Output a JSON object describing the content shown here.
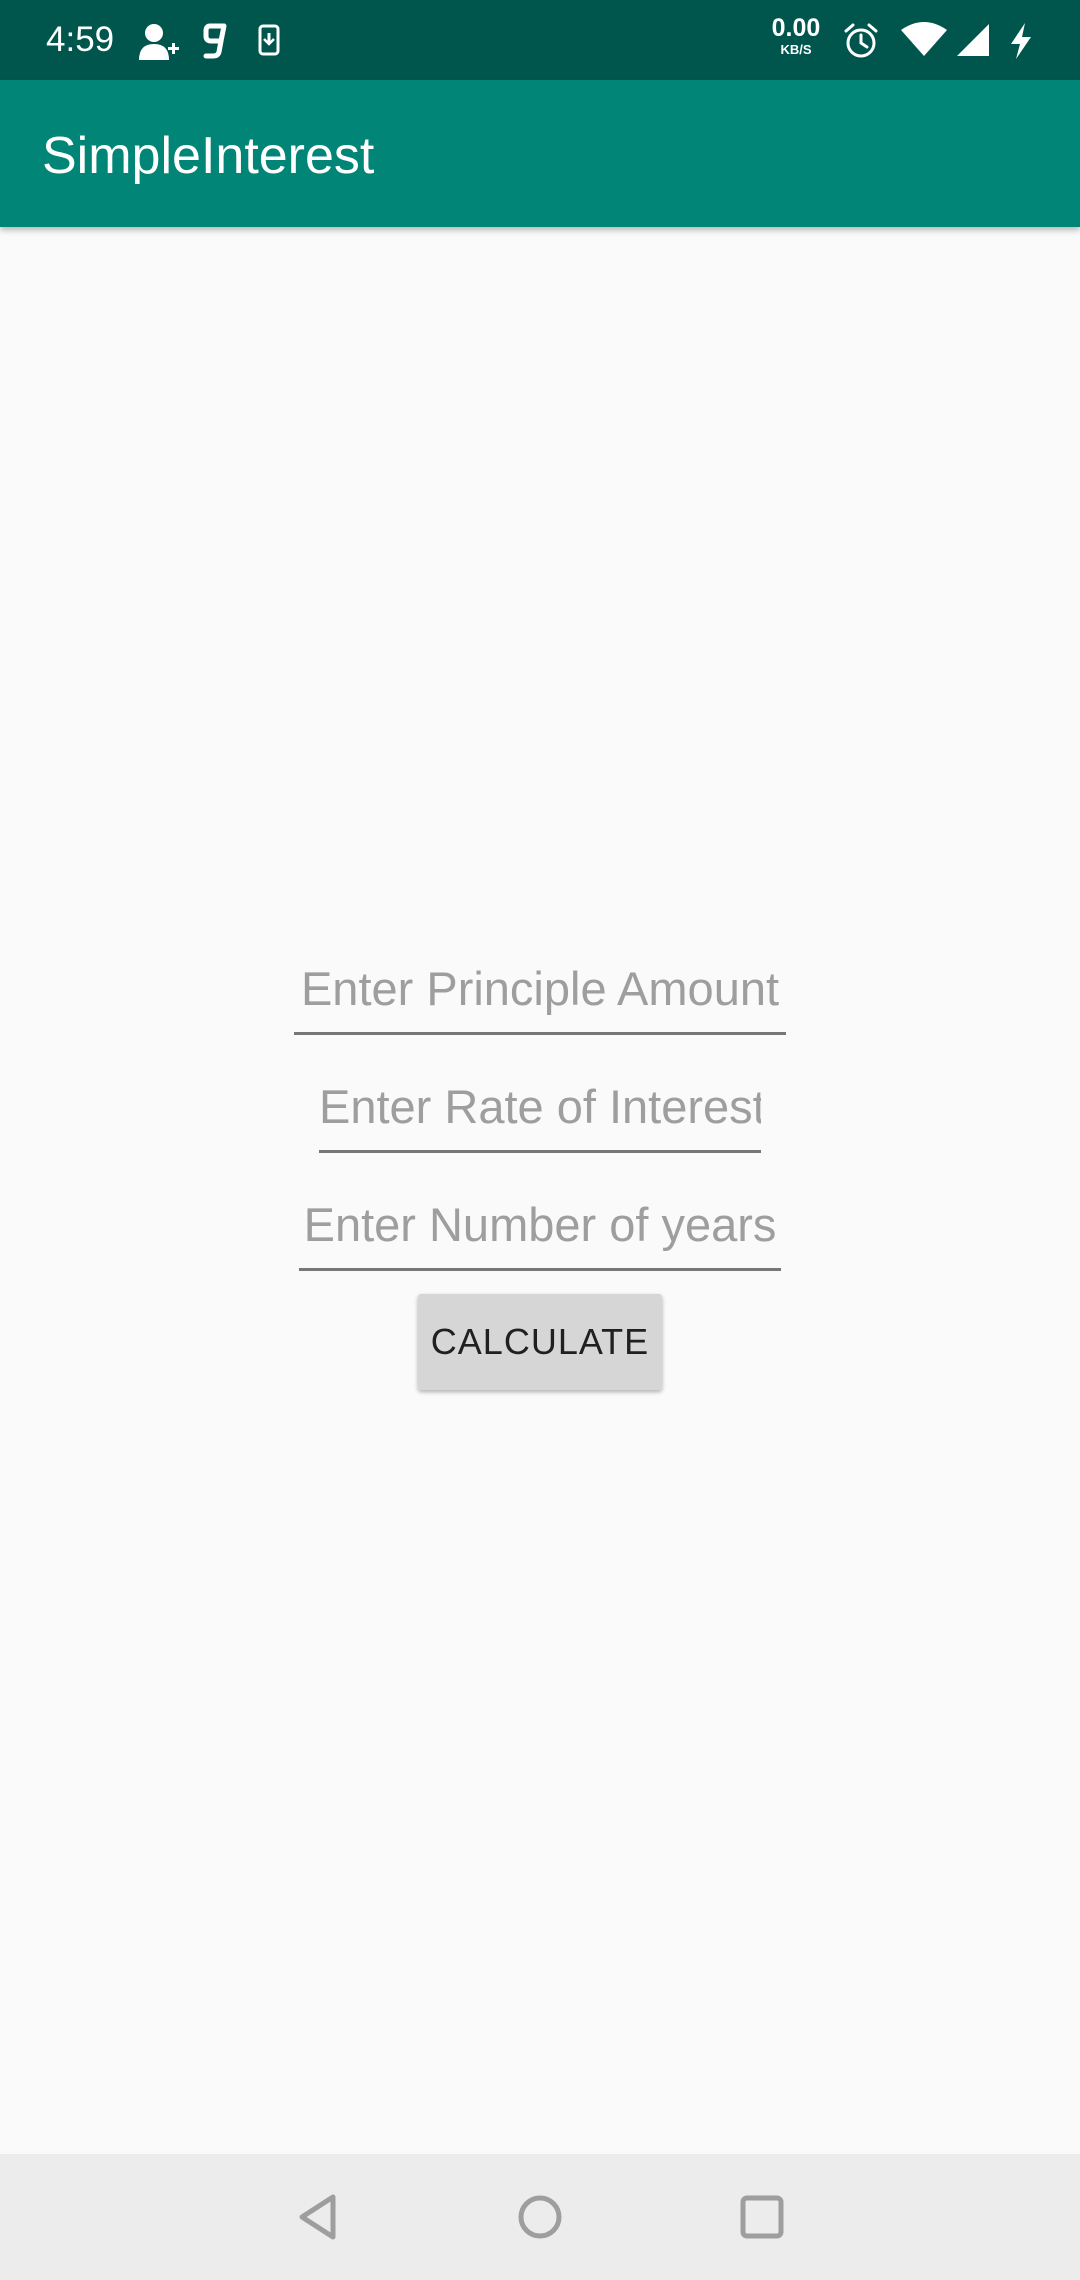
{
  "status_bar": {
    "time": "4:59",
    "net_speed_value": "0.00",
    "net_speed_unit": "KB/S",
    "icons": [
      "person-add-icon",
      "g-app-icon",
      "phone-download-icon",
      "alarm-icon",
      "wifi-icon",
      "cell-signal-icon",
      "charging-icon"
    ]
  },
  "app_bar": {
    "title": "SimpleInterest"
  },
  "form": {
    "principal_placeholder": "Enter Principle Amount",
    "rate_placeholder": "Enter Rate of Interest",
    "years_placeholder": "Enter Number of years",
    "calculate_label": "CALCULATE"
  },
  "nav_bar": {
    "icons": [
      "back-icon",
      "home-icon",
      "recents-icon"
    ]
  },
  "colors": {
    "status_bar": "#00564d",
    "app_bar": "#008577",
    "background": "#fafafa",
    "button": "#d6d6d6",
    "nav_bar": "#ececec"
  }
}
